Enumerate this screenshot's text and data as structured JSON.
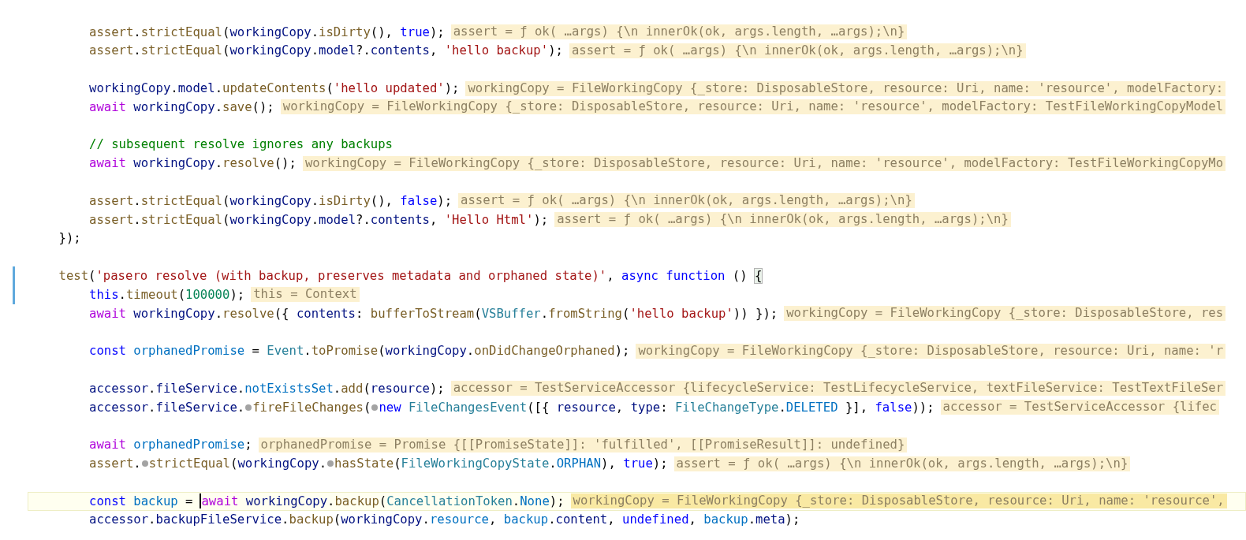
{
  "editor": {
    "lines": [
      {
        "current": false,
        "modified": false,
        "children": [
          {
            "current": false,
            "modified": false,
            "segments": [
              {
                "kind": "code",
                "tokens": [
                  {
                    "text": "assert",
                    "kind": "fn"
                  },
                  {
                    "text": ".",
                    "kind": "p"
                  },
                  {
                    "text": "strictEqual",
                    "kind": "fn"
                  },
                  {
                    "text": "(",
                    "kind": "p"
                  },
                  {
                    "text": "workingCopy",
                    "kind": "var"
                  },
                  {
                    "text": ".",
                    "kind": "p"
                  },
                  {
                    "text": "isDirty",
                    "kind": "fn"
                  },
                  {
                    "text": "(), ",
                    "kind": "p"
                  },
                  {
                    "text": "true",
                    "kind": "kw"
                  },
                  {
                    "text": ");",
                    "kind": "p"
                  }
                ]
              },
              {
                "kind": "hint",
                "text": "assert = ƒ ok( …args) {\\n innerOk(ok, args.length, …args);\\n}"
              }
            ]
          },
          {
            "current": false,
            "modified": false,
            "segments": [
              {
                "kind": "code",
                "tokens": [
                  {
                    "text": "assert",
                    "kind": "fn"
                  },
                  {
                    "text": ".",
                    "kind": "p"
                  },
                  {
                    "text": "strictEqual",
                    "kind": "fn"
                  },
                  {
                    "text": "(",
                    "kind": "p"
                  },
                  {
                    "text": "workingCopy",
                    "kind": "var"
                  },
                  {
                    "text": ".",
                    "kind": "p"
                  },
                  {
                    "text": "model",
                    "kind": "var"
                  },
                  {
                    "text": "?.",
                    "kind": "p"
                  },
                  {
                    "text": "contents",
                    "kind": "var"
                  },
                  {
                    "text": ", ",
                    "kind": "p"
                  },
                  {
                    "text": "'hello backup'",
                    "kind": "str"
                  },
                  {
                    "text": ");",
                    "kind": "p"
                  }
                ]
              },
              {
                "kind": "hint",
                "text": "assert = ƒ ok( …args) {\\n innerOk(ok, args.length, …args);\\n}"
              }
            ]
          },
          {
            "current": false,
            "modified": false
          },
          {
            "current": false,
            "modified": false,
            "segments": [
              {
                "kind": "code",
                "tokens": [
                  {
                    "text": "workingCopy",
                    "kind": "var"
                  },
                  {
                    "text": ".",
                    "kind": "p"
                  },
                  {
                    "text": "model",
                    "kind": "var"
                  },
                  {
                    "text": ".",
                    "kind": "p"
                  },
                  {
                    "text": "updateContents",
                    "kind": "fn"
                  },
                  {
                    "text": "(",
                    "kind": "p"
                  },
                  {
                    "text": "'hello updated'",
                    "kind": "str"
                  },
                  {
                    "text": ");",
                    "kind": "p"
                  }
                ]
              },
              {
                "kind": "hint",
                "text": "workingCopy = FileWorkingCopy {_store: DisposableStore, resource: Uri, name: 'resource', modelFactory:"
              }
            ]
          },
          {
            "current": false,
            "modified": false,
            "segments": [
              {
                "kind": "code",
                "tokens": [
                  {
                    "text": "await ",
                    "kind": "ctrl"
                  },
                  {
                    "text": "workingCopy",
                    "kind": "var"
                  },
                  {
                    "text": ".",
                    "kind": "p"
                  },
                  {
                    "text": "save",
                    "kind": "fn"
                  },
                  {
                    "text": "();",
                    "kind": "p"
                  }
                ]
              },
              {
                "kind": "hint",
                "text": "workingCopy = FileWorkingCopy {_store: DisposableStore, resource: Uri, name: 'resource', modelFactory: TestFileWorkingCopyModel"
              }
            ]
          },
          {
            "current": false,
            "modified": false
          },
          {
            "current": false,
            "modified": false,
            "segments": [
              {
                "kind": "code",
                "tokens": [
                  {
                    "text": "// subsequent resolve ignores any backups",
                    "kind": "cmt"
                  }
                ]
              }
            ]
          },
          {
            "current": false,
            "modified": false,
            "segments": [
              {
                "kind": "code",
                "tokens": [
                  {
                    "text": "await ",
                    "kind": "ctrl"
                  },
                  {
                    "text": "workingCopy",
                    "kind": "var"
                  },
                  {
                    "text": ".",
                    "kind": "p"
                  },
                  {
                    "text": "resolve",
                    "kind": "fn"
                  },
                  {
                    "text": "();",
                    "kind": "p"
                  }
                ]
              },
              {
                "kind": "hint",
                "text": "workingCopy = FileWorkingCopy {_store: DisposableStore, resource: Uri, name: 'resource', modelFactory: TestFileWorkingCopyMo"
              }
            ]
          },
          {
            "current": false,
            "modified": false
          },
          {
            "current": false,
            "modified": false,
            "segments": [
              {
                "kind": "code",
                "tokens": [
                  {
                    "text": "assert",
                    "kind": "fn"
                  },
                  {
                    "text": ".",
                    "kind": "p"
                  },
                  {
                    "text": "strictEqual",
                    "kind": "fn"
                  },
                  {
                    "text": "(",
                    "kind": "p"
                  },
                  {
                    "text": "workingCopy",
                    "kind": "var"
                  },
                  {
                    "text": ".",
                    "kind": "p"
                  },
                  {
                    "text": "isDirty",
                    "kind": "fn"
                  },
                  {
                    "text": "(), ",
                    "kind": "p"
                  },
                  {
                    "text": "false",
                    "kind": "kw"
                  },
                  {
                    "text": ");",
                    "kind": "p"
                  }
                ]
              },
              {
                "kind": "hint",
                "text": "assert = ƒ ok( …args) {\\n innerOk(ok, args.length, …args);\\n}"
              }
            ]
          },
          {
            "current": false,
            "modified": false,
            "segments": [
              {
                "kind": "code",
                "tokens": [
                  {
                    "text": "assert",
                    "kind": "fn"
                  },
                  {
                    "text": ".",
                    "kind": "p"
                  },
                  {
                    "text": "strictEqual",
                    "kind": "fn"
                  },
                  {
                    "text": "(",
                    "kind": "p"
                  },
                  {
                    "text": "workingCopy",
                    "kind": "var"
                  },
                  {
                    "text": ".",
                    "kind": "p"
                  },
                  {
                    "text": "model",
                    "kind": "var"
                  },
                  {
                    "text": "?.",
                    "kind": "p"
                  },
                  {
                    "text": "contents",
                    "kind": "var"
                  },
                  {
                    "text": ", ",
                    "kind": "p"
                  },
                  {
                    "text": "'Hello Html'",
                    "kind": "str"
                  },
                  {
                    "text": ");",
                    "kind": "p"
                  }
                ]
              },
              {
                "kind": "hint",
                "text": "assert = ƒ ok( …args) {\\n innerOk(ok, args.length, …args);\\n}"
              }
            ]
          }
        ]
      },
      {
        "current": false,
        "modified": false,
        "segments": [
          {
            "kind": "code",
            "tokens": [
              {
                "text": "});",
                "kind": "p"
              }
            ]
          }
        ]
      },
      {
        "current": false,
        "modified": false
      },
      {
        "current": false,
        "modified": true,
        "segments": [
          {
            "kind": "code",
            "tokens": [
              {
                "text": "test",
                "kind": "fn"
              },
              {
                "text": "(",
                "kind": "p"
              },
              {
                "text": "'pasero resolve (with backup, preserves metadata and orphaned state)'",
                "kind": "str"
              },
              {
                "text": ", ",
                "kind": "p"
              },
              {
                "text": "async function",
                "kind": "kw"
              },
              {
                "text": " () ",
                "kind": "p"
              },
              {
                "text": "{",
                "kind": "bracket"
              }
            ]
          }
        ],
        "children": [
          {
            "current": false,
            "modified": true,
            "segments": [
              {
                "kind": "code",
                "tokens": [
                  {
                    "text": "this",
                    "kind": "kw"
                  },
                  {
                    "text": ".",
                    "kind": "p"
                  },
                  {
                    "text": "timeout",
                    "kind": "fn"
                  },
                  {
                    "text": "(",
                    "kind": "p"
                  },
                  {
                    "text": "100000",
                    "kind": "num"
                  },
                  {
                    "text": ");",
                    "kind": "p"
                  }
                ]
              },
              {
                "kind": "hint",
                "text": "this = Context"
              }
            ]
          },
          {
            "current": false,
            "modified": false,
            "segments": [
              {
                "kind": "code",
                "tokens": [
                  {
                    "text": "await ",
                    "kind": "ctrl"
                  },
                  {
                    "text": "workingCopy",
                    "kind": "var"
                  },
                  {
                    "text": ".",
                    "kind": "p"
                  },
                  {
                    "text": "resolve",
                    "kind": "fn"
                  },
                  {
                    "text": "({ ",
                    "kind": "p"
                  },
                  {
                    "text": "contents",
                    "kind": "var"
                  },
                  {
                    "text": ": ",
                    "kind": "p"
                  },
                  {
                    "text": "bufferToStream",
                    "kind": "fn"
                  },
                  {
                    "text": "(",
                    "kind": "p"
                  },
                  {
                    "text": "VSBuffer",
                    "kind": "type"
                  },
                  {
                    "text": ".",
                    "kind": "p"
                  },
                  {
                    "text": "fromString",
                    "kind": "fn"
                  },
                  {
                    "text": "(",
                    "kind": "p"
                  },
                  {
                    "text": "'hello backup'",
                    "kind": "str"
                  },
                  {
                    "text": ")) });",
                    "kind": "p"
                  }
                ]
              },
              {
                "kind": "hint",
                "text": "workingCopy = FileWorkingCopy {_store: DisposableStore, res"
              }
            ]
          },
          {
            "current": false,
            "modified": false
          },
          {
            "current": false,
            "modified": false,
            "segments": [
              {
                "kind": "code",
                "tokens": [
                  {
                    "text": "const ",
                    "kind": "kw"
                  },
                  {
                    "text": "orphanedPromise",
                    "kind": "const"
                  },
                  {
                    "text": " = ",
                    "kind": "p"
                  },
                  {
                    "text": "Event",
                    "kind": "type"
                  },
                  {
                    "text": ".",
                    "kind": "p"
                  },
                  {
                    "text": "toPromise",
                    "kind": "fn"
                  },
                  {
                    "text": "(",
                    "kind": "p"
                  },
                  {
                    "text": "workingCopy",
                    "kind": "var"
                  },
                  {
                    "text": ".",
                    "kind": "p"
                  },
                  {
                    "text": "onDidChangeOrphaned",
                    "kind": "fn"
                  },
                  {
                    "text": ");",
                    "kind": "p"
                  }
                ]
              },
              {
                "kind": "hint",
                "text": "workingCopy = FileWorkingCopy {_store: DisposableStore, resource: Uri, name: 'r"
              }
            ]
          },
          {
            "current": false,
            "modified": false
          },
          {
            "current": false,
            "modified": false,
            "segments": [
              {
                "kind": "code",
                "tokens": [
                  {
                    "text": "accessor",
                    "kind": "var"
                  },
                  {
                    "text": ".",
                    "kind": "p"
                  },
                  {
                    "text": "fileService",
                    "kind": "var"
                  },
                  {
                    "text": ".",
                    "kind": "p"
                  },
                  {
                    "text": "notExistsSet",
                    "kind": "const"
                  },
                  {
                    "text": ".",
                    "kind": "p"
                  },
                  {
                    "text": "add",
                    "kind": "fn"
                  },
                  {
                    "text": "(",
                    "kind": "p"
                  },
                  {
                    "text": "resource",
                    "kind": "var"
                  },
                  {
                    "text": ");",
                    "kind": "p"
                  }
                ]
              },
              {
                "kind": "hint",
                "text": "accessor = TestServiceAccessor {lifecycleService: TestLifecycleService, textFileService: TestTextFileSer"
              }
            ]
          },
          {
            "current": false,
            "modified": false,
            "segments": [
              {
                "kind": "code",
                "tokens": [
                  {
                    "text": "accessor",
                    "kind": "var"
                  },
                  {
                    "text": ".",
                    "kind": "p"
                  },
                  {
                    "text": "fileService",
                    "kind": "var"
                  },
                  {
                    "text": ".",
                    "kind": "p"
                  }
                ]
              },
              {
                "kind": "dot"
              },
              {
                "kind": "code",
                "tokens": [
                  {
                    "text": "fireFileChanges",
                    "kind": "fn"
                  },
                  {
                    "text": "(",
                    "kind": "p"
                  }
                ]
              },
              {
                "kind": "dot"
              },
              {
                "kind": "code",
                "tokens": [
                  {
                    "text": "new ",
                    "kind": "kw"
                  },
                  {
                    "text": "FileChangesEvent",
                    "kind": "type"
                  },
                  {
                    "text": "([{ ",
                    "kind": "p"
                  },
                  {
                    "text": "resource",
                    "kind": "var"
                  },
                  {
                    "text": ", ",
                    "kind": "p"
                  },
                  {
                    "text": "type",
                    "kind": "var"
                  },
                  {
                    "text": ": ",
                    "kind": "p"
                  },
                  {
                    "text": "FileChangeType",
                    "kind": "type"
                  },
                  {
                    "text": ".",
                    "kind": "p"
                  },
                  {
                    "text": "DELETED",
                    "kind": "const"
                  },
                  {
                    "text": " }], ",
                    "kind": "p"
                  },
                  {
                    "text": "false",
                    "kind": "kw"
                  },
                  {
                    "text": "));",
                    "kind": "p"
                  }
                ]
              },
              {
                "kind": "hint",
                "text": "accessor = TestServiceAccessor {lifec"
              }
            ]
          },
          {
            "current": false,
            "modified": false
          },
          {
            "current": false,
            "modified": false,
            "segments": [
              {
                "kind": "code",
                "tokens": [
                  {
                    "text": "await ",
                    "kind": "ctrl"
                  },
                  {
                    "text": "orphanedPromise",
                    "kind": "const"
                  },
                  {
                    "text": ";",
                    "kind": "p"
                  }
                ]
              },
              {
                "kind": "hint",
                "text": "orphanedPromise = Promise {[[PromiseState]]: 'fulfilled', [[PromiseResult]]: undefined}"
              }
            ]
          },
          {
            "current": false,
            "modified": false,
            "segments": [
              {
                "kind": "code",
                "tokens": [
                  {
                    "text": "assert",
                    "kind": "fn"
                  },
                  {
                    "text": ".",
                    "kind": "p"
                  }
                ]
              },
              {
                "kind": "dot"
              },
              {
                "kind": "code",
                "tokens": [
                  {
                    "text": "strictEqual",
                    "kind": "fn"
                  },
                  {
                    "text": "(",
                    "kind": "p"
                  },
                  {
                    "text": "workingCopy",
                    "kind": "var"
                  },
                  {
                    "text": ".",
                    "kind": "p"
                  }
                ]
              },
              {
                "kind": "dot"
              },
              {
                "kind": "code",
                "tokens": [
                  {
                    "text": "hasState",
                    "kind": "fn"
                  },
                  {
                    "text": "(",
                    "kind": "p"
                  },
                  {
                    "text": "FileWorkingCopyState",
                    "kind": "type"
                  },
                  {
                    "text": ".",
                    "kind": "p"
                  },
                  {
                    "text": "ORPHAN",
                    "kind": "const"
                  },
                  {
                    "text": "), ",
                    "kind": "p"
                  },
                  {
                    "text": "true",
                    "kind": "kw"
                  },
                  {
                    "text": ");",
                    "kind": "p"
                  }
                ]
              },
              {
                "kind": "hint",
                "text": "assert = ƒ ok( …args) {\\n innerOk(ok, args.length, …args);\\n}"
              }
            ]
          },
          {
            "current": false,
            "modified": false
          },
          {
            "current": true,
            "modified": false,
            "segments": [
              {
                "kind": "code",
                "tokens": [
                  {
                    "text": "const ",
                    "kind": "kw"
                  },
                  {
                    "text": "backup",
                    "kind": "const"
                  },
                  {
                    "text": " =",
                    "kind": "p"
                  }
                ]
              },
              {
                "kind": "cursor"
              },
              {
                "kind": "code",
                "tokens": [
                  {
                    "text": "await ",
                    "kind": "ctrl"
                  },
                  {
                    "text": "workingCopy",
                    "kind": "var"
                  },
                  {
                    "text": ".",
                    "kind": "p"
                  },
                  {
                    "text": "backup",
                    "kind": "fn"
                  },
                  {
                    "text": "(",
                    "kind": "p"
                  },
                  {
                    "text": "CancellationToken",
                    "kind": "type"
                  },
                  {
                    "text": ".",
                    "kind": "p"
                  },
                  {
                    "text": "None",
                    "kind": "const"
                  },
                  {
                    "text": ");",
                    "kind": "p"
                  }
                ]
              },
              {
                "kind": "hint",
                "text": "workingCopy = FileWorkingCopy {_store: DisposableStore, resource: Uri, name: 'resource',"
              }
            ]
          },
          {
            "current": false,
            "modified": false,
            "segments": [
              {
                "kind": "code",
                "tokens": [
                  {
                    "text": "accessor",
                    "kind": "var"
                  },
                  {
                    "text": ".",
                    "kind": "p"
                  },
                  {
                    "text": "backupFileService",
                    "kind": "var"
                  },
                  {
                    "text": ".",
                    "kind": "p"
                  },
                  {
                    "text": "backup",
                    "kind": "fn"
                  },
                  {
                    "text": "(",
                    "kind": "p"
                  },
                  {
                    "text": "workingCopy",
                    "kind": "var"
                  },
                  {
                    "text": ".",
                    "kind": "p"
                  },
                  {
                    "text": "resource",
                    "kind": "const"
                  },
                  {
                    "text": ", ",
                    "kind": "p"
                  },
                  {
                    "text": "backup",
                    "kind": "const"
                  },
                  {
                    "text": ".",
                    "kind": "p"
                  },
                  {
                    "text": "content",
                    "kind": "var"
                  },
                  {
                    "text": ", ",
                    "kind": "p"
                  },
                  {
                    "text": "undefined",
                    "kind": "kw"
                  },
                  {
                    "text": ", ",
                    "kind": "p"
                  },
                  {
                    "text": "backup",
                    "kind": "const"
                  },
                  {
                    "text": ".",
                    "kind": "p"
                  },
                  {
                    "text": "meta",
                    "kind": "var"
                  },
                  {
                    "text": ");",
                    "kind": "p"
                  }
                ]
              }
            ]
          }
        ]
      }
    ]
  }
}
